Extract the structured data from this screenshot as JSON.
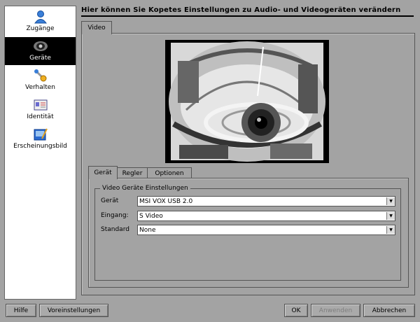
{
  "header": {
    "title": "Hier können Sie Kopetes Einstellungen zu Audio- und Videogeräten verändern"
  },
  "sidebar": {
    "items": [
      {
        "label": "Zugänge",
        "icon": "user-accounts-icon"
      },
      {
        "label": "Geräte",
        "icon": "webcam-icon",
        "selected": true
      },
      {
        "label": "Verhalten",
        "icon": "wrench-icon"
      },
      {
        "label": "Identität",
        "icon": "id-card-icon"
      },
      {
        "label": "Erscheinungsbild",
        "icon": "appearance-paint-icon"
      }
    ]
  },
  "outer_tab": {
    "label": "Video"
  },
  "inner_tabs": [
    {
      "label": "Gerät",
      "active": true
    },
    {
      "label": "Regler"
    },
    {
      "label": "Optionen"
    }
  ],
  "group": {
    "title": "Video Geräte Einstellungen",
    "rows": [
      {
        "label": "Gerät",
        "value": "MSI VOX USB 2.0"
      },
      {
        "label": "Eingang:",
        "value": "S Video"
      },
      {
        "label": "Standard",
        "value": "None"
      }
    ]
  },
  "buttons": {
    "help": "Hilfe",
    "defaults": "Voreinstellungen",
    "ok": "OK",
    "apply": "Anwenden",
    "cancel": "Abbrechen"
  }
}
